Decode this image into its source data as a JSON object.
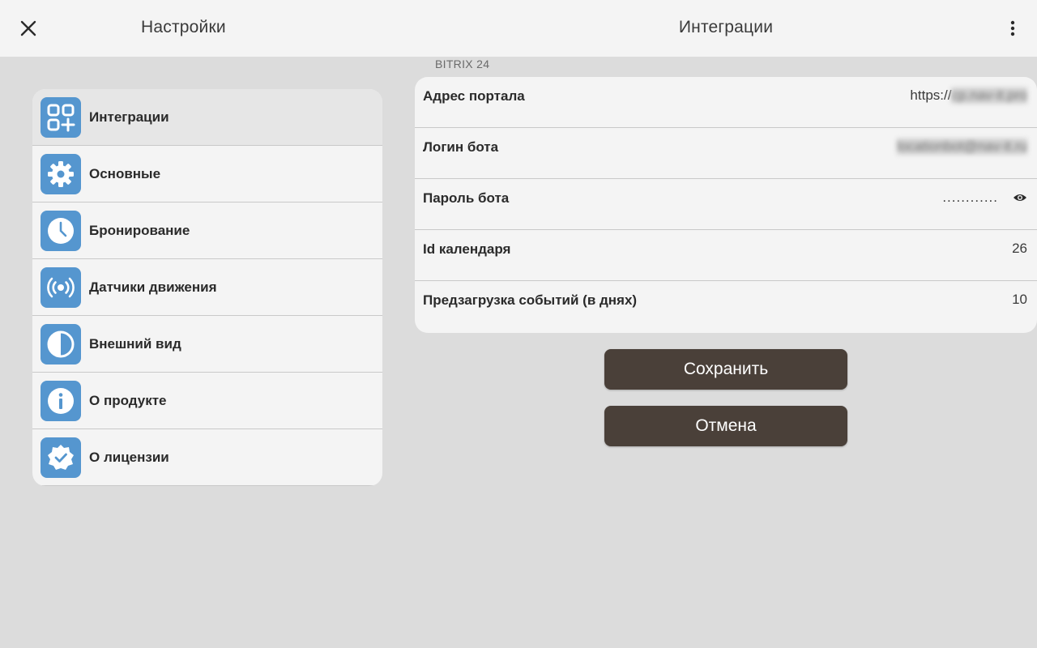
{
  "header": {
    "left_title": "Настройки",
    "right_title": "Интеграции"
  },
  "sidebar": {
    "items": [
      {
        "label": "Интеграции",
        "icon": "integrations-icon",
        "active": true
      },
      {
        "label": "Основные",
        "icon": "gear-icon",
        "active": false
      },
      {
        "label": "Бронирование",
        "icon": "clock-icon",
        "active": false
      },
      {
        "label": "Датчики движения",
        "icon": "motion-sensor-icon",
        "active": false
      },
      {
        "label": "Внешний вид",
        "icon": "contrast-icon",
        "active": false
      },
      {
        "label": "О продукте",
        "icon": "info-icon",
        "active": false
      },
      {
        "label": "О лицензии",
        "icon": "verified-badge-icon",
        "active": false
      }
    ]
  },
  "section": {
    "title": "BITRIX 24"
  },
  "fields": {
    "portal": {
      "label": "Адрес портала",
      "prefix": "https://",
      "value_blurred": "cp.nav-it.pro"
    },
    "login": {
      "label": "Логин бота",
      "value_blurred": "locationbot@nav-it.ru"
    },
    "password": {
      "label": "Пароль бота",
      "value": "............"
    },
    "calendar": {
      "label": "Id календаря",
      "value": "26"
    },
    "preload": {
      "label": "Предзагрузка событий (в днях)",
      "value": "10"
    }
  },
  "buttons": {
    "save": "Сохранить",
    "cancel": "Отмена"
  },
  "colors": {
    "accent_icon": "#5596cf",
    "button": "#4a4039",
    "background": "#dcdcdc",
    "card": "#f4f4f4"
  }
}
